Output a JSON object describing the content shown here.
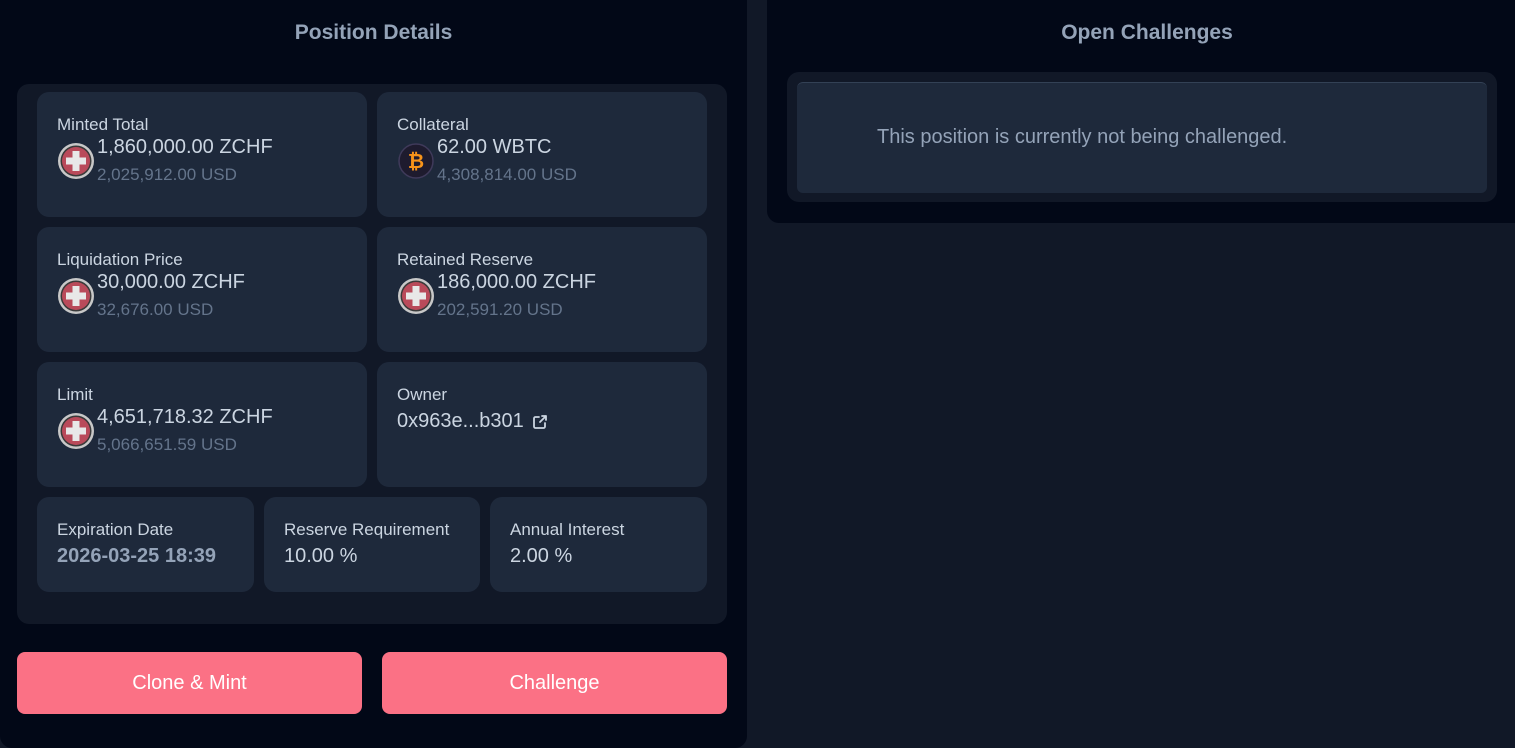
{
  "position_details": {
    "title": "Position Details",
    "minted_total": {
      "label": "Minted Total",
      "amount": "1,860,000.00 ZCHF",
      "usd": "2,025,912.00 USD",
      "icon": "zchf-coin-icon"
    },
    "collateral": {
      "label": "Collateral",
      "amount": "62.00 WBTC",
      "usd": "4,308,814.00 USD",
      "icon": "bitcoin-icon"
    },
    "liquidation_price": {
      "label": "Liquidation Price",
      "amount": "30,000.00 ZCHF",
      "usd": "32,676.00 USD",
      "icon": "zchf-coin-icon"
    },
    "retained_reserve": {
      "label": "Retained Reserve",
      "amount": "186,000.00 ZCHF",
      "usd": "202,591.20 USD",
      "icon": "zchf-coin-icon"
    },
    "limit": {
      "label": "Limit",
      "amount": "4,651,718.32 ZCHF",
      "usd": "5,066,651.59 USD",
      "icon": "zchf-coin-icon"
    },
    "owner": {
      "label": "Owner",
      "address": "0x963e...b301",
      "icon": "external-link-icon"
    },
    "expiration": {
      "label": "Expiration Date",
      "value": "2026-03-25 18:39"
    },
    "reserve_requirement": {
      "label": "Reserve Requirement",
      "value": "10.00 %"
    },
    "annual_interest": {
      "label": "Annual Interest",
      "value": "2.00 %"
    }
  },
  "actions": {
    "clone_mint": "Clone & Mint",
    "challenge": "Challenge"
  },
  "open_challenges": {
    "title": "Open Challenges",
    "empty_message": "This position is currently not being challenged."
  },
  "colors": {
    "page_bg": "#111827",
    "panel_bg": "#020817",
    "card_bg": "#1e293b",
    "accent": "#fb7185",
    "bitcoin": "#f7931a",
    "swiss_red": "#b94a5a"
  }
}
